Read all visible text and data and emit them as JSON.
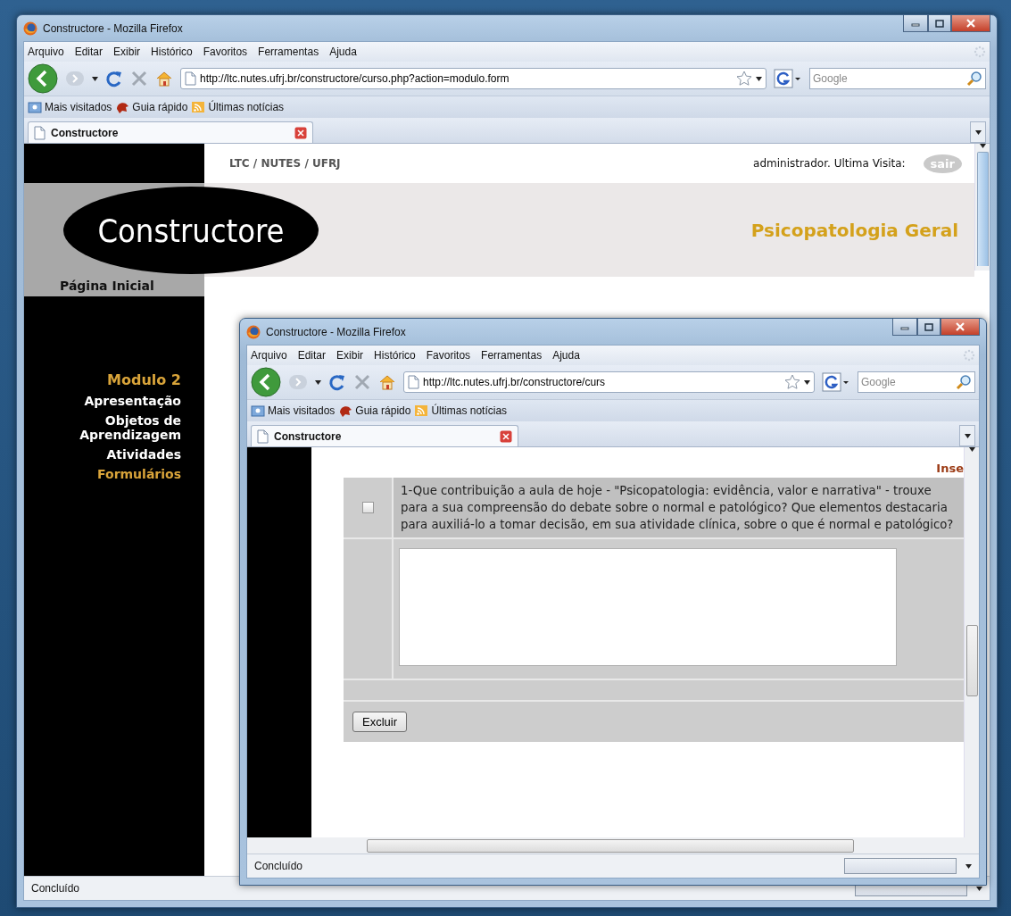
{
  "windows": [
    {
      "kind": "course_page",
      "title": "Constructore - Mozilla Firefox",
      "menu": [
        "Arquivo",
        "Editar",
        "Exibir",
        "Histórico",
        "Favoritos",
        "Ferramentas",
        "Ajuda"
      ],
      "url": "http://ltc.nutes.ufrj.br/constructore/curso.php?action=modulo.form",
      "search_placeholder": "Google",
      "bookmarks": [
        "Mais visitados",
        "Guia rápido",
        "Últimas notícias"
      ],
      "tabs": [
        {
          "label": "Constructore",
          "selected": true
        }
      ],
      "status": "Concluído",
      "page": {
        "breadcrumb": "LTC / NUTES / UFRJ",
        "user_info": "administrador. Ultima Visita:",
        "logout": "sair",
        "logo": "Constructore",
        "course_title": "Psicopatologia Geral",
        "home": "Página Inicial",
        "module_title": "Modulo 2",
        "nav": [
          {
            "label": "Apresentação",
            "selected": false
          },
          {
            "label": "Objetos de Aprendizagem",
            "selected": false
          },
          {
            "label": "Atividades",
            "selected": false
          },
          {
            "label": "Formulários",
            "selected": true
          }
        ]
      }
    },
    {
      "kind": "form_page",
      "title": "Constructore - Mozilla Firefox",
      "menu": [
        "Arquivo",
        "Editar",
        "Exibir",
        "Histórico",
        "Favoritos",
        "Ferramentas",
        "Ajuda"
      ],
      "url": "http://ltc.nutes.ufrj.br/constructore/curs",
      "search_placeholder": "Google",
      "bookmarks": [
        "Mais visitados",
        "Guia rápido",
        "Últimas notícias"
      ],
      "tabs": [
        {
          "label": "Constructore",
          "selected": true
        }
      ],
      "status": "Concluído",
      "page": {
        "insert_link": "Inse",
        "question": {
          "text": "1-Que contribuição a aula de hoje - \"Psicopatologia: evidência, valor e narrativa\" - trouxe para a sua compreensão do debate sobre o normal e patológico? Que elementos destacaria para auxiliá-lo a tomar decisão, em sua atividade clínica, sobre o que é normal e patológico?",
          "checked": false
        },
        "delete_button": "Excluir"
      }
    }
  ]
}
